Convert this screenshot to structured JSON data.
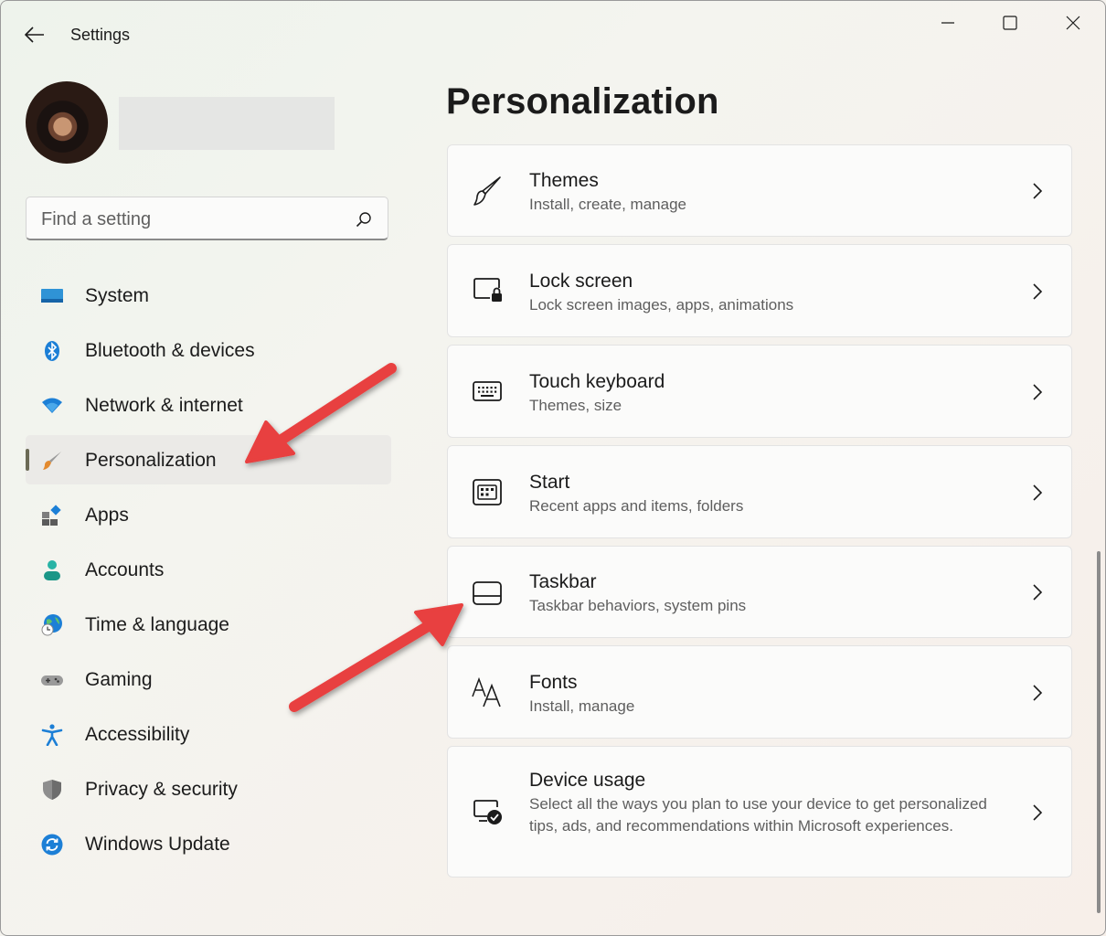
{
  "window": {
    "title": "Settings",
    "buttons": [
      "minimize",
      "maximize",
      "close"
    ]
  },
  "search": {
    "placeholder": "Find a setting"
  },
  "sidebar": {
    "items": [
      {
        "label": "System",
        "icon": "system-icon"
      },
      {
        "label": "Bluetooth & devices",
        "icon": "bluetooth-icon"
      },
      {
        "label": "Network & internet",
        "icon": "wifi-icon"
      },
      {
        "label": "Personalization",
        "icon": "brush-icon",
        "selected": true
      },
      {
        "label": "Apps",
        "icon": "apps-icon"
      },
      {
        "label": "Accounts",
        "icon": "accounts-icon"
      },
      {
        "label": "Time & language",
        "icon": "globe-clock-icon"
      },
      {
        "label": "Gaming",
        "icon": "gamepad-icon"
      },
      {
        "label": "Accessibility",
        "icon": "accessibility-icon"
      },
      {
        "label": "Privacy & security",
        "icon": "shield-icon"
      },
      {
        "label": "Windows Update",
        "icon": "update-icon"
      }
    ]
  },
  "main": {
    "title": "Personalization",
    "cards": [
      {
        "title": "Themes",
        "subtitle": "Install, create, manage",
        "icon": "brush-outline-icon"
      },
      {
        "title": "Lock screen",
        "subtitle": "Lock screen images, apps, animations",
        "icon": "lock-screen-icon"
      },
      {
        "title": "Touch keyboard",
        "subtitle": "Themes, size",
        "icon": "keyboard-icon"
      },
      {
        "title": "Start",
        "subtitle": "Recent apps and items, folders",
        "icon": "start-icon"
      },
      {
        "title": "Taskbar",
        "subtitle": "Taskbar behaviors, system pins",
        "icon": "taskbar-icon"
      },
      {
        "title": "Fonts",
        "subtitle": "Install, manage",
        "icon": "fonts-icon"
      },
      {
        "title": "Device usage",
        "subtitle": "Select all the ways you plan to use your device to get personalized tips, ads, and recommendations within Microsoft experiences.",
        "icon": "device-usage-icon"
      }
    ]
  },
  "colors": {
    "annotation_arrow": "#e8403f",
    "selection_bg": "#ebeae7",
    "accent_blue": "#0f6cbd"
  }
}
